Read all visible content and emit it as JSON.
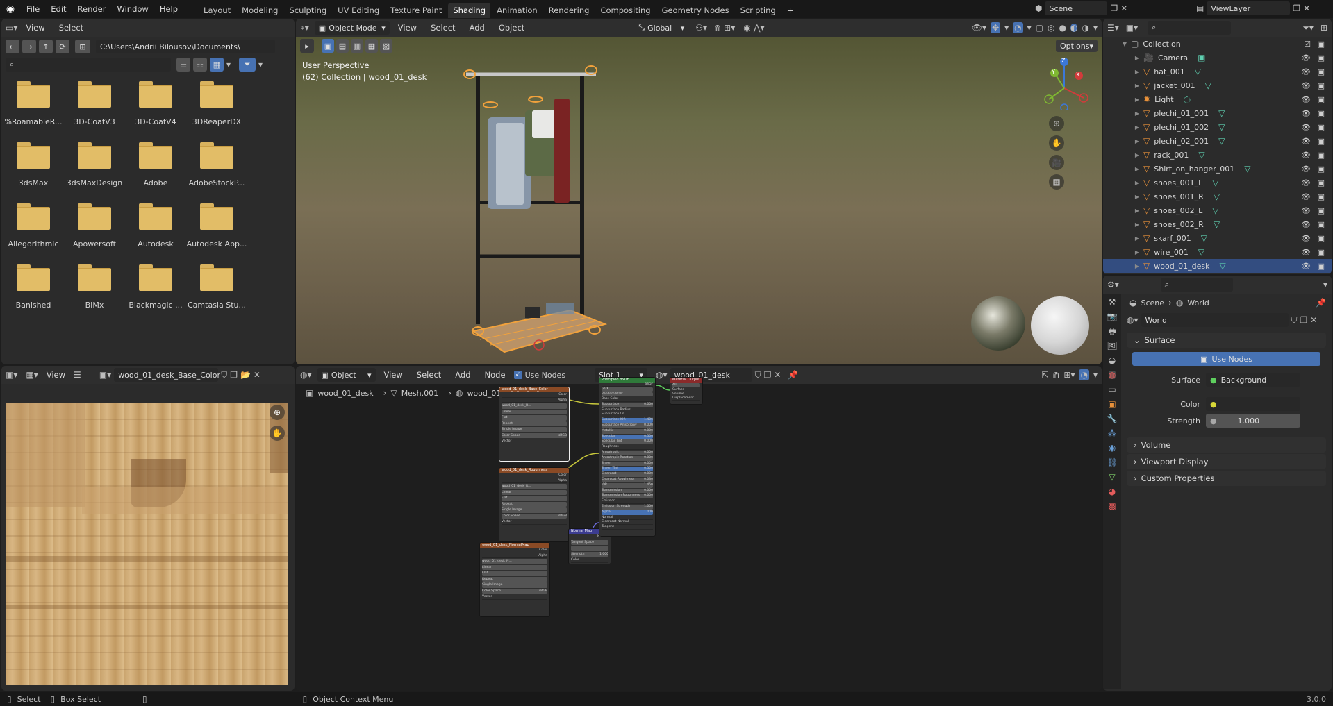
{
  "topbar": {
    "menus": [
      "File",
      "Edit",
      "Render",
      "Window",
      "Help"
    ],
    "workspaces": [
      "Layout",
      "Modeling",
      "Sculpting",
      "UV Editing",
      "Texture Paint",
      "Shading",
      "Animation",
      "Rendering",
      "Compositing",
      "Geometry Nodes",
      "Scripting"
    ],
    "active_workspace": "Shading",
    "add_tab": "+",
    "scene": "Scene",
    "view_layer": "ViewLayer"
  },
  "file_browser": {
    "menus": [
      "View",
      "Select"
    ],
    "path": "C:\\Users\\Andrii Bilousov\\Documents\\",
    "folders": [
      "%RoamableR...",
      "3D-CoatV3",
      "3D-CoatV4",
      "3DReaperDX",
      "3dsMax",
      "3dsMaxDesign",
      "Adobe",
      "AdobeStockP...",
      "Allegorithmic",
      "Apowersoft",
      "Autodesk",
      "Autodesk App...",
      "Banished",
      "BIMx",
      "Blackmagic ...",
      "Camtasia Stu..."
    ]
  },
  "viewport": {
    "mode": "Object Mode",
    "menus": [
      "View",
      "Select",
      "Add",
      "Object"
    ],
    "orientation": "Global",
    "options": "Options",
    "overlay_title": "User Perspective",
    "overlay_sub": "(62) Collection | wood_01_desk",
    "gizmo": {
      "x": "X",
      "y": "Y",
      "z": "Z"
    }
  },
  "outliner": {
    "collection": "Collection",
    "items": [
      "Camera",
      "hat_001",
      "jacket_001",
      "Light",
      "plechi_01_001",
      "plechi_01_002",
      "plechi_02_001",
      "rack_001",
      "Shirt_on_hanger_001",
      "shoes_001_L",
      "shoes_001_R",
      "shoes_002_L",
      "shoes_002_R",
      "skarf_001",
      "wire_001",
      "wood_01_desk"
    ],
    "selected": "wood_01_desk"
  },
  "properties": {
    "breadcrumb_scene": "Scene",
    "breadcrumb_world": "World",
    "world_name": "World",
    "surface_panel": "Surface",
    "use_nodes_btn": "Use Nodes",
    "surface_label": "Surface",
    "surface_value": "Background",
    "color_label": "Color",
    "strength_label": "Strength",
    "strength_value": "1.000",
    "panels": [
      "Volume",
      "Viewport Display",
      "Custom Properties"
    ]
  },
  "image_editor": {
    "view_menu": "View",
    "image_name": "wood_01_desk_Base_Color"
  },
  "node_editor": {
    "type": "Object",
    "menus": [
      "View",
      "Select",
      "Add",
      "Node"
    ],
    "use_nodes": "Use Nodes",
    "slot": "Slot 1",
    "material": "wood_01_desk",
    "breadcrumb": [
      "wood_01_desk",
      "Mesh.001",
      "wood_01_desk"
    ]
  },
  "nodes": {
    "img1": {
      "title": "wood_01_desk_Base_Color",
      "file": "wood_01_desk_B..."
    },
    "img2": {
      "title": "wood_01_desk_Roughness",
      "file": "wood_01_desk_R..."
    },
    "img3": {
      "title": "wood_01_desk_NormalMap",
      "file": "wood_01_desk_N..."
    },
    "normal": {
      "title": "Normal Map",
      "space": "Tangent Space",
      "strength": "1.000"
    },
    "bsdf": {
      "title": "Principled BSDF",
      "model": "GGX",
      "ss_method": "Random Walk"
    },
    "output": {
      "title": "Material Output",
      "target": "All"
    },
    "img_rows": [
      "Color",
      "Alpha",
      "Linear",
      "Flat",
      "Repeat",
      "Single Image",
      "Color Space",
      "sRGB",
      "Vector"
    ],
    "bsdf_rows": [
      {
        "label": "Base Color",
        "value": ""
      },
      {
        "label": "Subsurface",
        "value": "0.000"
      },
      {
        "label": "Subsurface Radius",
        "value": ""
      },
      {
        "label": "Subsurface Co",
        "value": ""
      },
      {
        "label": "Subsurface IOR",
        "value": "1.400"
      },
      {
        "label": "Subsurface Anisotropy",
        "value": "0.000"
      },
      {
        "label": "Metallic",
        "value": "0.000"
      },
      {
        "label": "Specular",
        "value": "0.500"
      },
      {
        "label": "Specular Tint",
        "value": "0.000"
      },
      {
        "label": "Roughness",
        "value": ""
      },
      {
        "label": "Anisotropic",
        "value": "0.000"
      },
      {
        "label": "Anisotropic Rotation",
        "value": "0.000"
      },
      {
        "label": "Sheen",
        "value": "0.000"
      },
      {
        "label": "Sheen Tint",
        "value": "0.500"
      },
      {
        "label": "Clearcoat",
        "value": "0.000"
      },
      {
        "label": "Clearcoat Roughness",
        "value": "0.030"
      },
      {
        "label": "IOR",
        "value": "1.450"
      },
      {
        "label": "Transmission",
        "value": "0.000"
      },
      {
        "label": "Transmission Roughness",
        "value": "0.000"
      },
      {
        "label": "Emission",
        "value": ""
      },
      {
        "label": "Emission Strength",
        "value": "1.000"
      },
      {
        "label": "Alpha",
        "value": "1.000"
      },
      {
        "label": "Normal",
        "value": ""
      },
      {
        "label": "Clearcoat Normal",
        "value": ""
      },
      {
        "label": "Tangent",
        "value": ""
      }
    ],
    "out_rows": [
      "Surface",
      "Volume",
      "Displacement"
    ],
    "sock": {
      "color": "Color",
      "alpha": "Alpha",
      "normal": "Normal",
      "bsdf": "BSDF"
    }
  },
  "statusbar": {
    "select": "Select",
    "box_select": "Box Select",
    "context": "Object Context Menu",
    "version": "3.0.0"
  },
  "colors": {
    "accent": "#4772b3",
    "selected_row": "#334d80",
    "folder": "#e2bd67",
    "mesh_icon": "#e8913a"
  }
}
